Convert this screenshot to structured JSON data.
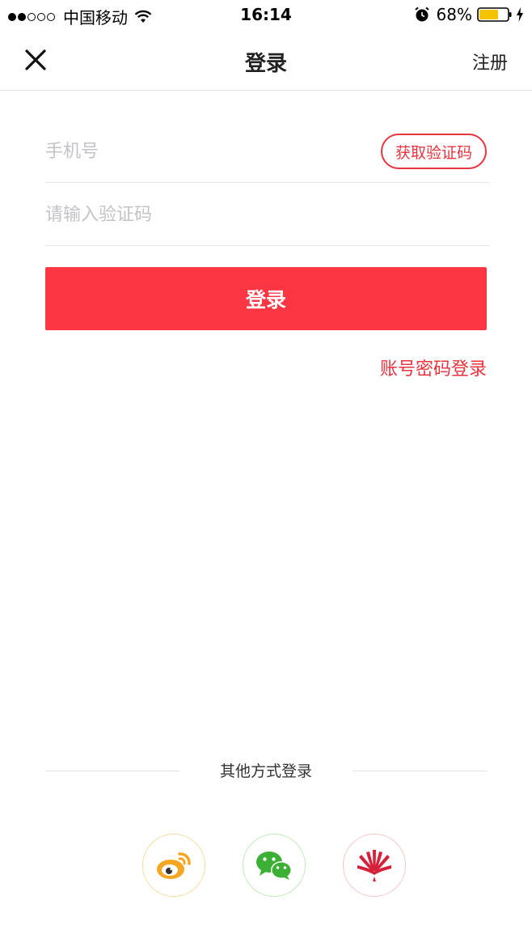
{
  "status_bar": {
    "carrier": "中国移动",
    "time": "16:14",
    "battery": "68%",
    "battery_level": 0.68,
    "signal_bars_filled": 2,
    "signal_bars_total": 5
  },
  "nav": {
    "title": "登录",
    "register_label": "注册"
  },
  "form": {
    "phone_placeholder": "手机号",
    "get_code_label": "获取验证码",
    "code_placeholder": "请输入验证码",
    "login_label": "登录",
    "password_login_label": "账号密码登录"
  },
  "other_login": {
    "label": "其他方式登录",
    "providers": [
      {
        "id": "weibo",
        "icon": "weibo-icon",
        "color": "#f5a623"
      },
      {
        "id": "wechat",
        "icon": "wechat-icon",
        "color": "#3cb034"
      },
      {
        "id": "xiaomi",
        "icon": "xiaomi-icon",
        "color": "#d6213b"
      }
    ]
  },
  "colors": {
    "accent": "#fd3644",
    "accent_text": "#e8343f",
    "divider": "#e3e3e3",
    "placeholder": "#c3c3c8"
  }
}
